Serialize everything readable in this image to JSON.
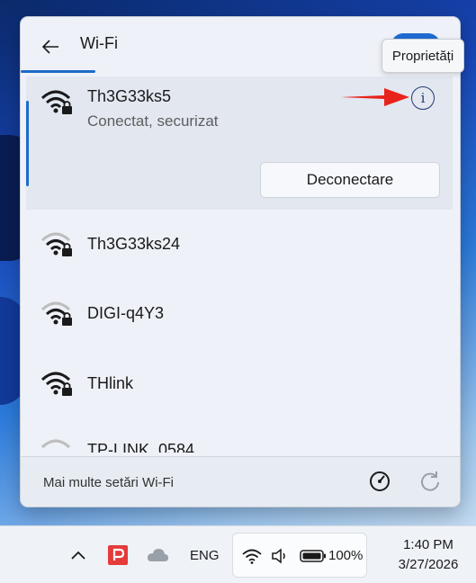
{
  "flyout": {
    "title": "Wi-Fi",
    "wifi_toggle_on": true,
    "tooltip": "Proprietăți",
    "networks": [
      {
        "name": "Th3G33ks5",
        "status": "Conectat, securizat",
        "disconnect_label": "Deconectare"
      },
      {
        "name": "Th3G33ks24"
      },
      {
        "name": "DIGI-q4Y3"
      },
      {
        "name": "THlink"
      },
      {
        "name": "TP-LINK_0584"
      }
    ],
    "footer": {
      "more_settings": "Mai multe setări Wi-Fi"
    }
  },
  "taskbar": {
    "language": "ENG",
    "battery": "100%",
    "time": "1:40 PM",
    "date": "3/27/2026"
  },
  "colors": {
    "accent": "#1d6bc7",
    "arrow": "#e8231c",
    "info_icon": "#243a73"
  },
  "icons": [
    "back-arrow-icon",
    "wifi-lock-icon",
    "info-icon",
    "network-speed-icon",
    "refresh-icon",
    "chevron-up-icon",
    "app-icon",
    "cloud-icon",
    "wifi-icon",
    "volume-icon",
    "battery-icon"
  ]
}
